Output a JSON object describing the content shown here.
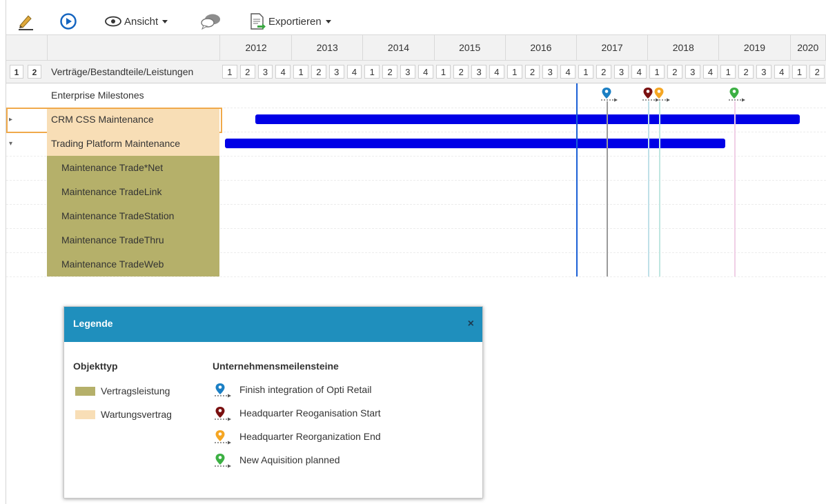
{
  "toolbar": {
    "view_label": "Ansicht",
    "export_label": "Exportieren"
  },
  "timeline": {
    "level_buttons": [
      "1",
      "2"
    ],
    "column_header": "Verträge/Bestandteile/Leistungen",
    "years": [
      "2012",
      "2013",
      "2014",
      "2015",
      "2016",
      "2017",
      "2018",
      "2019",
      "2020"
    ],
    "quarters": [
      "1",
      "2",
      "3",
      "4"
    ]
  },
  "rows": [
    {
      "name": "Enterprise Milestones",
      "type": "milestones",
      "toggle": ""
    },
    {
      "name": "CRM CSS Maintenance",
      "type": "wartung",
      "toggle": "▸",
      "selected": true,
      "bar": {
        "start": "2012-Q2 mid",
        "end": "2020-Q1 end"
      }
    },
    {
      "name": "Trading Platform Maintenance",
      "type": "wartung",
      "toggle": "▾",
      "bar": {
        "start": "2012-Q1",
        "end": "2019-Q1 end"
      }
    },
    {
      "name": "Maintenance Trade*Net",
      "type": "leistung",
      "toggle": ""
    },
    {
      "name": "Maintenance TradeLink",
      "type": "leistung",
      "toggle": ""
    },
    {
      "name": "Maintenance TradeStation",
      "type": "leistung",
      "toggle": ""
    },
    {
      "name": "Maintenance TradeThru",
      "type": "leistung",
      "toggle": ""
    },
    {
      "name": "Maintenance TradeWeb",
      "type": "leistung",
      "toggle": ""
    }
  ],
  "milestones": [
    {
      "name": "Finish integration of Opti Retail",
      "color": "#1b7fc4",
      "when": "2017-Q2"
    },
    {
      "name": "Headquarter Reoganisation Start",
      "color": "#7a1010",
      "when": "2017-Q4"
    },
    {
      "name": "Headquarter Reorganization End",
      "color": "#f5a623",
      "when": "2018-Q1"
    },
    {
      "name": "New Aquisition planned",
      "color": "#3cb043",
      "when": "2019-Q1"
    }
  ],
  "colors": {
    "bar": "#0000e6",
    "today_line": "#1a5fd6",
    "wartungsvertrag": "#f8deb6",
    "vertragsleistung": "#b5b06a",
    "legend_header": "#1f8fbd"
  },
  "legend": {
    "title": "Legende",
    "close": "×",
    "objecttype_heading": "Objekttyp",
    "object_types": [
      {
        "label": "Vertragsleistung",
        "color": "#b5b06a"
      },
      {
        "label": "Wartungsvertrag",
        "color": "#f8deb6"
      }
    ],
    "milestones_heading": "Unternehmensmeilensteine"
  }
}
